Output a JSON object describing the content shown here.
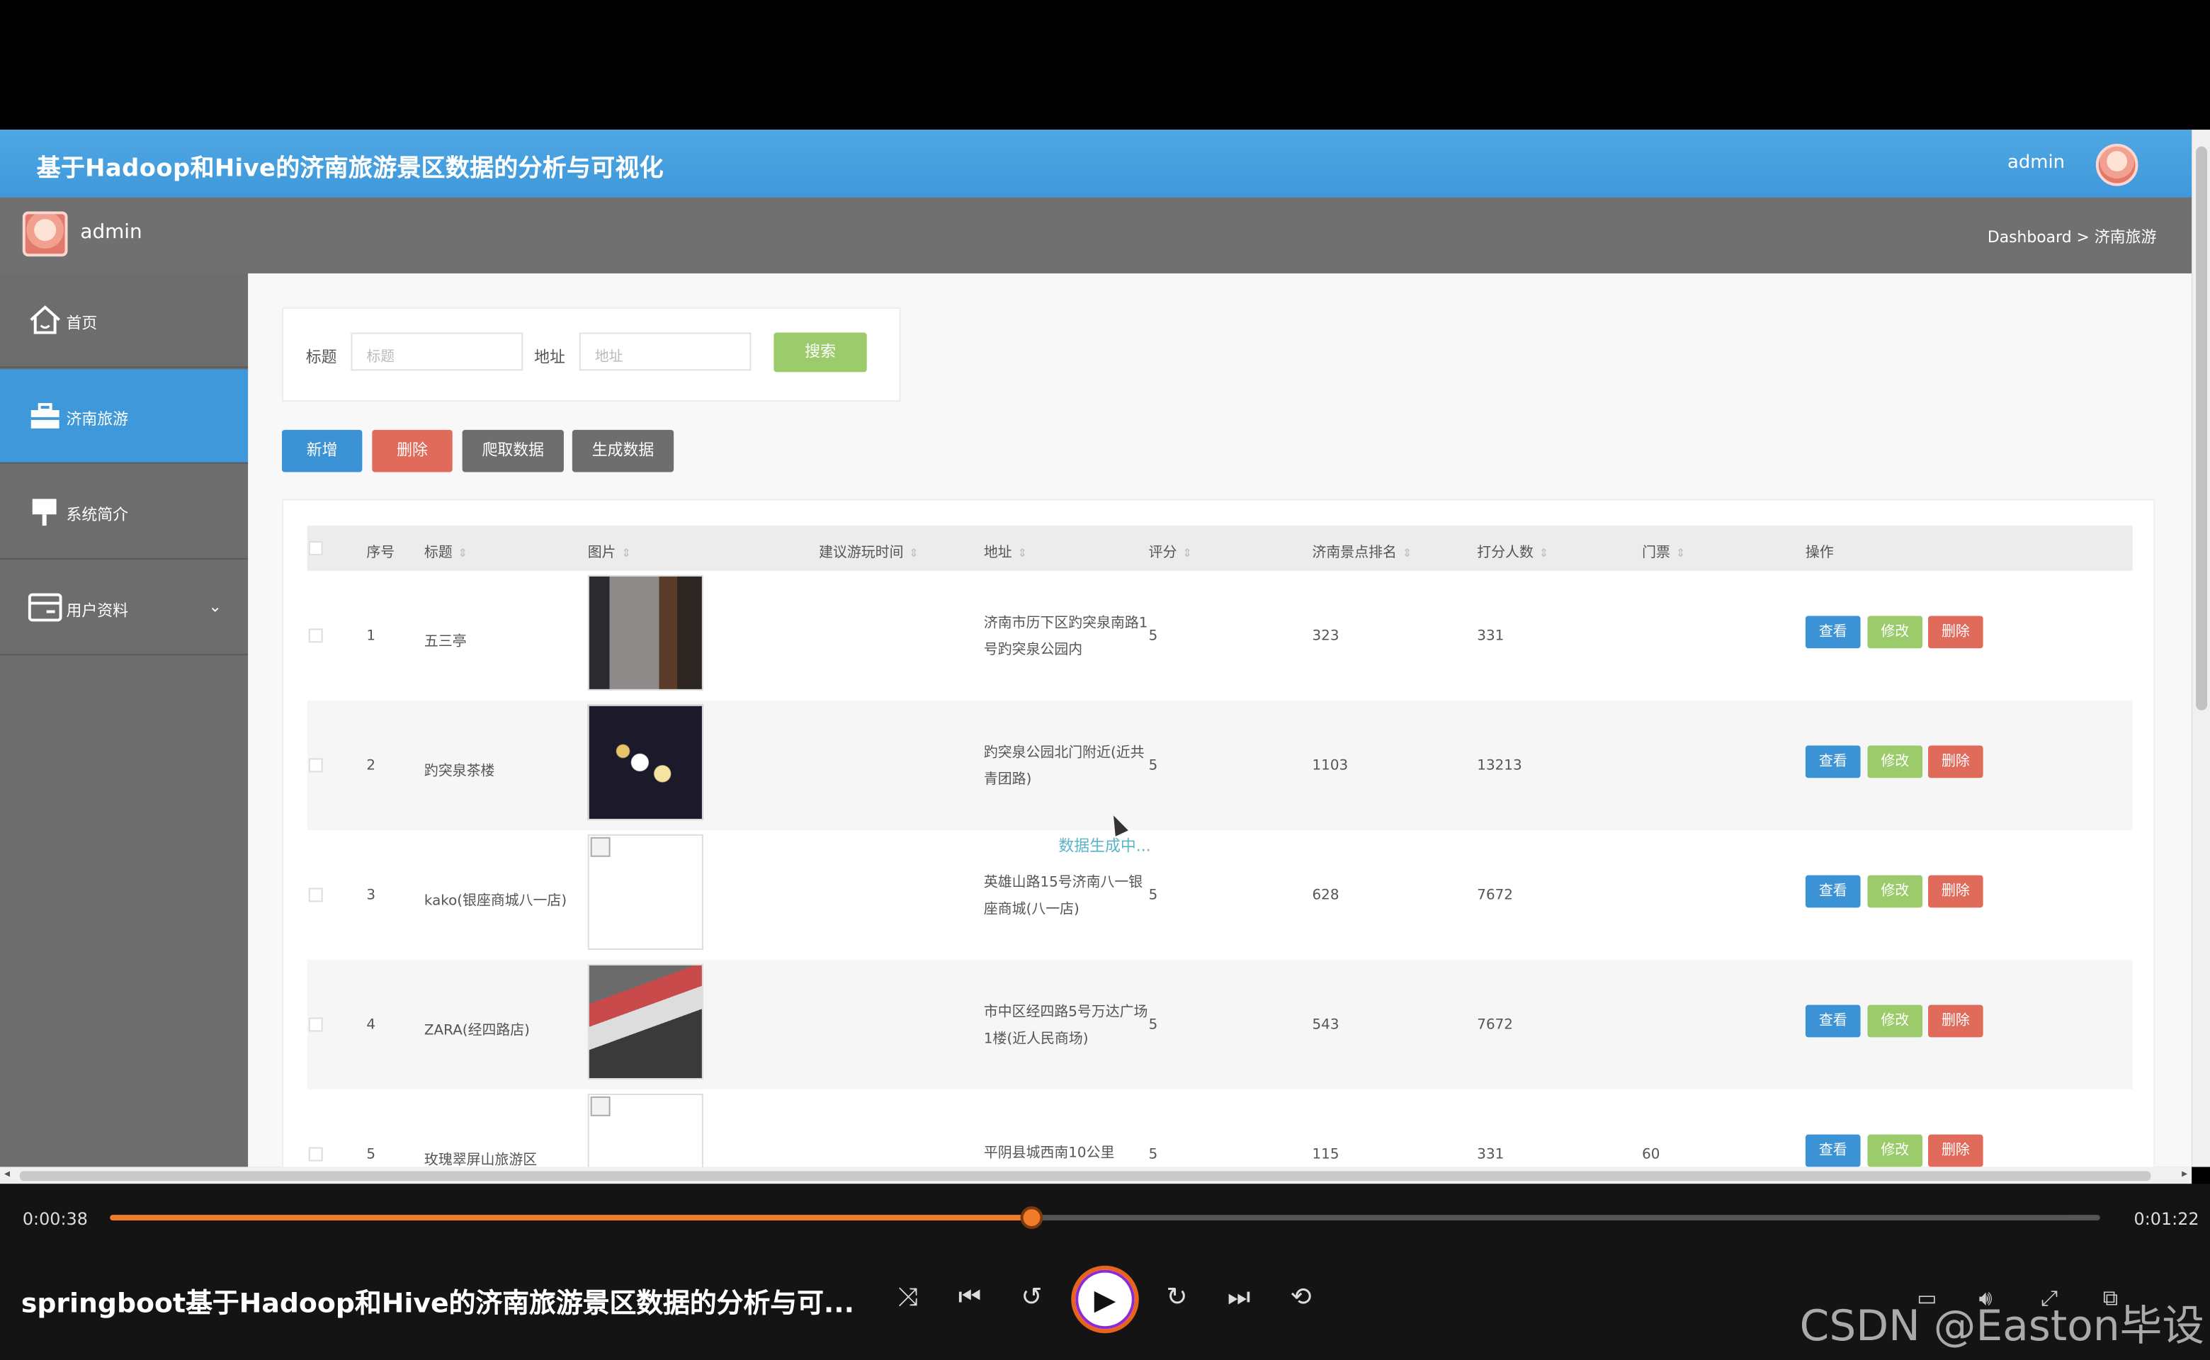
{
  "app": {
    "title": "基于Hadoop和Hive的济南旅游景区数据的分析与可视化",
    "user": "admin"
  },
  "subbar": {
    "user": "admin",
    "breadcrumb": "Dashboard > 济南旅游"
  },
  "sidebar": {
    "items": [
      {
        "label": "首页",
        "icon": "home-icon"
      },
      {
        "label": "济南旅游",
        "icon": "briefcase-icon",
        "active": true
      },
      {
        "label": "系统简介",
        "icon": "info-board-icon"
      },
      {
        "label": "用户资料",
        "icon": "user-card-icon",
        "chevron": "⌄"
      }
    ]
  },
  "search": {
    "title_label": "标题",
    "title_placeholder": "标题",
    "address_label": "地址",
    "address_placeholder": "地址",
    "button": "搜索"
  },
  "toolbar": {
    "add": "新增",
    "delete": "删除",
    "crawl": "爬取数据",
    "generate": "生成数据"
  },
  "table": {
    "columns": [
      "序号",
      "标题",
      "图片",
      "建议游玩时间",
      "地址",
      "评分",
      "济南景点排名",
      "打分人数",
      "门票",
      "操作"
    ],
    "rows": [
      {
        "no": "1",
        "title": "五三亭",
        "time": "",
        "address": "济南市历下区趵突泉南路1号趵突泉公园内",
        "score": "5",
        "rank": "323",
        "count": "331",
        "ticket": ""
      },
      {
        "no": "2",
        "title": "趵突泉茶楼",
        "time": "",
        "address": "趵突泉公园北门附近(近共青团路)",
        "score": "5",
        "rank": "1103",
        "count": "13213",
        "ticket": ""
      },
      {
        "no": "3",
        "title": "kako(银座商城八一店)",
        "time": "",
        "address": "英雄山路15号济南八一银座商城(八一店)",
        "score": "5",
        "rank": "628",
        "count": "7672",
        "ticket": ""
      },
      {
        "no": "4",
        "title": "ZARA(经四路店)",
        "time": "",
        "address": "市中区经四路5号万达广场1楼(近人民商场)",
        "score": "5",
        "rank": "543",
        "count": "7672",
        "ticket": ""
      },
      {
        "no": "5",
        "title": "玫瑰翠屏山旅游区",
        "time": "",
        "address": "平阴县城西南10公里",
        "score": "5",
        "rank": "115",
        "count": "331",
        "ticket": "60"
      }
    ],
    "actions": {
      "view": "查看",
      "edit": "修改",
      "delete": "删除"
    }
  },
  "loading_text": "数据生成中...",
  "player": {
    "current_time": "0:00:38",
    "total_time": "0:01:22",
    "progress": 0.4635,
    "title": "springboot基于Hadoop和Hive的济南旅游景区数据的分析与可...",
    "watermark": "CSDN @Easton毕设"
  }
}
